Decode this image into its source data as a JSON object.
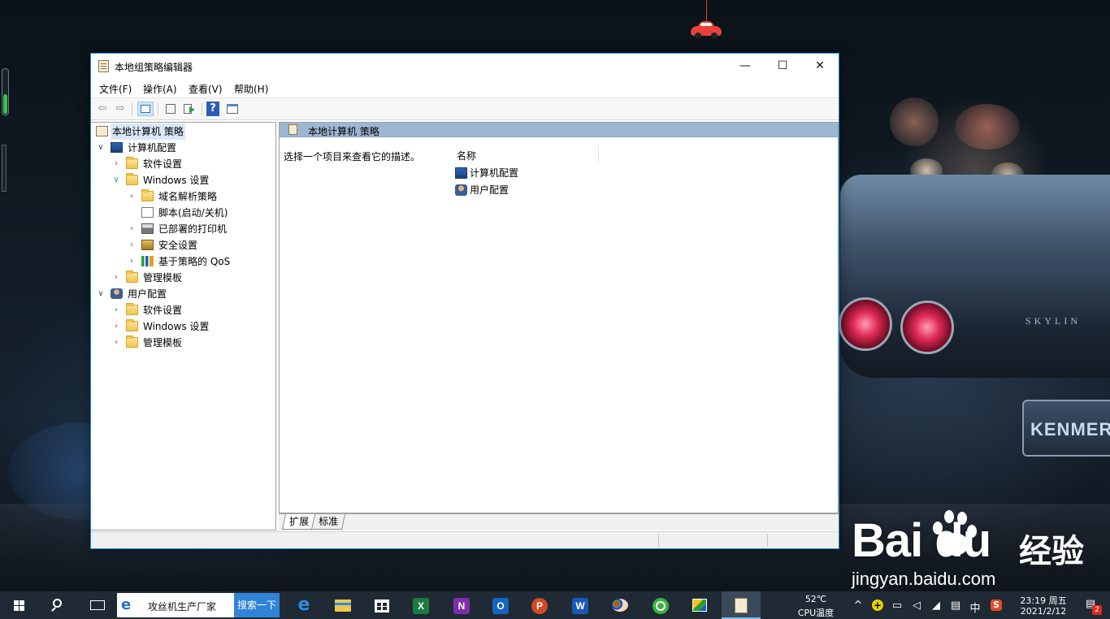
{
  "window": {
    "title": "本地组策略编辑器",
    "minimize_glyph": "—",
    "maximize_glyph": "☐",
    "close_glyph": "✕"
  },
  "menu": {
    "file": "文件(F)",
    "action": "操作(A)",
    "view": "查看(V)",
    "help": "帮助(H)"
  },
  "toolbar": {
    "back": "⇦",
    "forward": "⇨",
    "help": "?"
  },
  "tree": {
    "root": "本地计算机 策略",
    "computer_config": "计算机配置",
    "software_settings": "软件设置",
    "windows_settings": "Windows 设置",
    "name_resolution": "域名解析策略",
    "scripts": "脚本(启动/关机)",
    "printers": "已部署的打印机",
    "security": "安全设置",
    "qos": "基于策略的 QoS",
    "admin_templates": "管理模板",
    "user_config": "用户配置",
    "user_software": "软件设置",
    "user_windows": "Windows 设置",
    "user_admin": "管理模板"
  },
  "content": {
    "header": "本地计算机 策略",
    "description": "选择一个项目来查看它的描述。",
    "column_name": "名称",
    "items": [
      "计算机配置",
      "用户配置"
    ]
  },
  "tabs": {
    "extended": "扩展",
    "standard": "标准"
  },
  "taskbar": {
    "search_text": "攻丝机生产厂家",
    "search_button": "搜索一下",
    "temperature": "52℃",
    "temperature_label": "CPU温度",
    "ime": "中",
    "time": "23:19 周五",
    "date": "2021/2/12",
    "notification_count": "2",
    "apps": [
      "X",
      "N",
      "O",
      "P",
      "W"
    ]
  },
  "watermark": {
    "brand": "Bai  du",
    "brand_cn": "经验",
    "url": "jingyan.baidu.com"
  },
  "wallpaper": {
    "plate_text": "KENMER",
    "badge_text": "SKYLIN"
  },
  "colors": {
    "accent": "#1a8fd6",
    "header_bar": "#9fb6d3",
    "selected": "#d9e8f7",
    "taskbar": "#1f2a35"
  }
}
